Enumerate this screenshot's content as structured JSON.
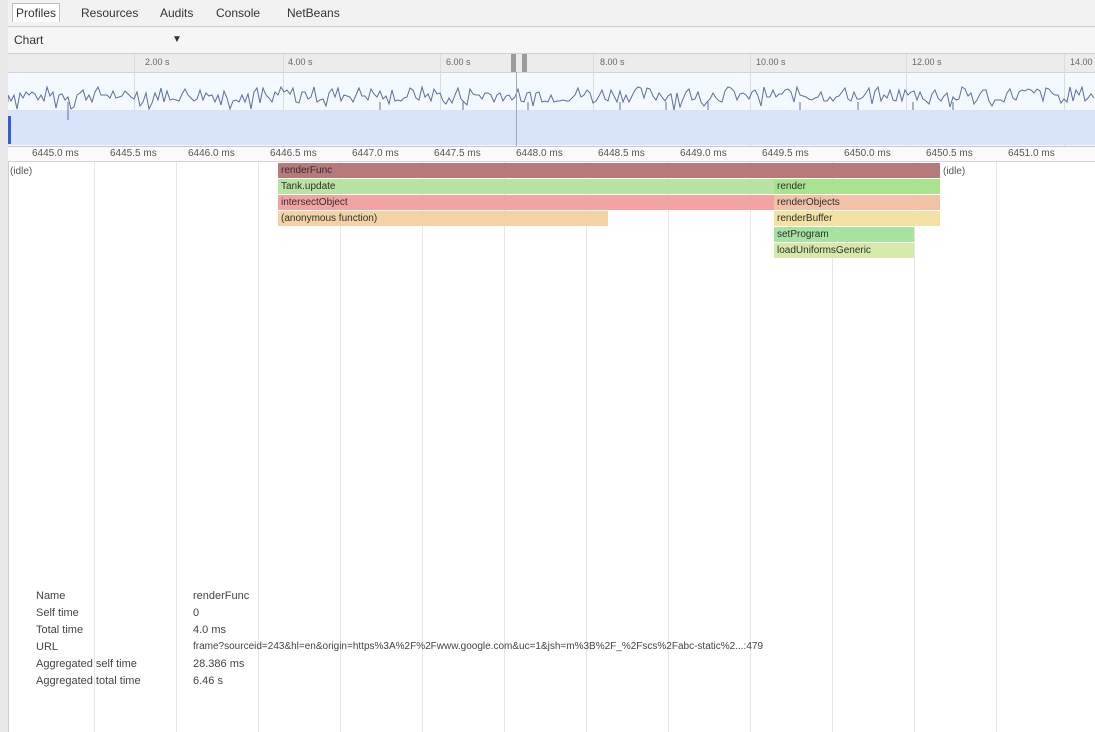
{
  "tabs": [
    "Profiles",
    "Resources",
    "Audits",
    "Console",
    "NetBeans"
  ],
  "active_tab": "Profiles",
  "view_select": {
    "value": "Chart"
  },
  "overview_ticks": [
    "2.00 s",
    "4.00 s",
    "6.00 s",
    "8.00 s",
    "10.00 s",
    "12.00 s",
    "14.00"
  ],
  "ruler_ticks": [
    "6445.0 ms",
    "6445.5 ms",
    "6446.0 ms",
    "6446.5 ms",
    "6447.0 ms",
    "6447.5 ms",
    "6448.0 ms",
    "6448.5 ms",
    "6449.0 ms",
    "6449.5 ms",
    "6450.0 ms",
    "6450.5 ms",
    "6451.0 ms"
  ],
  "flame": {
    "idle_left": "(idle)",
    "idle_right": "(idle)",
    "frames": [
      {
        "label": "renderFunc",
        "color": "#b77a7a"
      },
      {
        "label": "Tank.update",
        "color": "#b8e3a0"
      },
      {
        "label": "intersectObject",
        "color": "#f2a3a3"
      },
      {
        "label": "(anonymous function)",
        "color": "#f3d2a5"
      },
      {
        "label": "render",
        "color": "#a9e38f"
      },
      {
        "label": "renderObjects",
        "color": "#f3c1a8"
      },
      {
        "label": "renderBuffer",
        "color": "#f3e2a3"
      },
      {
        "label": "setProgram",
        "color": "#a6e2a0"
      },
      {
        "label": "loadUniformsGeneric",
        "color": "#d6e9a8"
      }
    ]
  },
  "details": {
    "rows": [
      {
        "label": "Name",
        "value": "renderFunc"
      },
      {
        "label": "Self time",
        "value": "0"
      },
      {
        "label": "Total time",
        "value": "4.0 ms"
      },
      {
        "label": "URL",
        "value": "frame?sourceid=243&hl=en&origin=https%3A%2F%2Fwww.google.com&uc=1&jsh=m%3B%2F_%2Fscs%2Fabc-static%2...:479"
      },
      {
        "label": "Aggregated self time",
        "value": "28.386 ms"
      },
      {
        "label": "Aggregated total time",
        "value": "6.46 s"
      }
    ]
  }
}
